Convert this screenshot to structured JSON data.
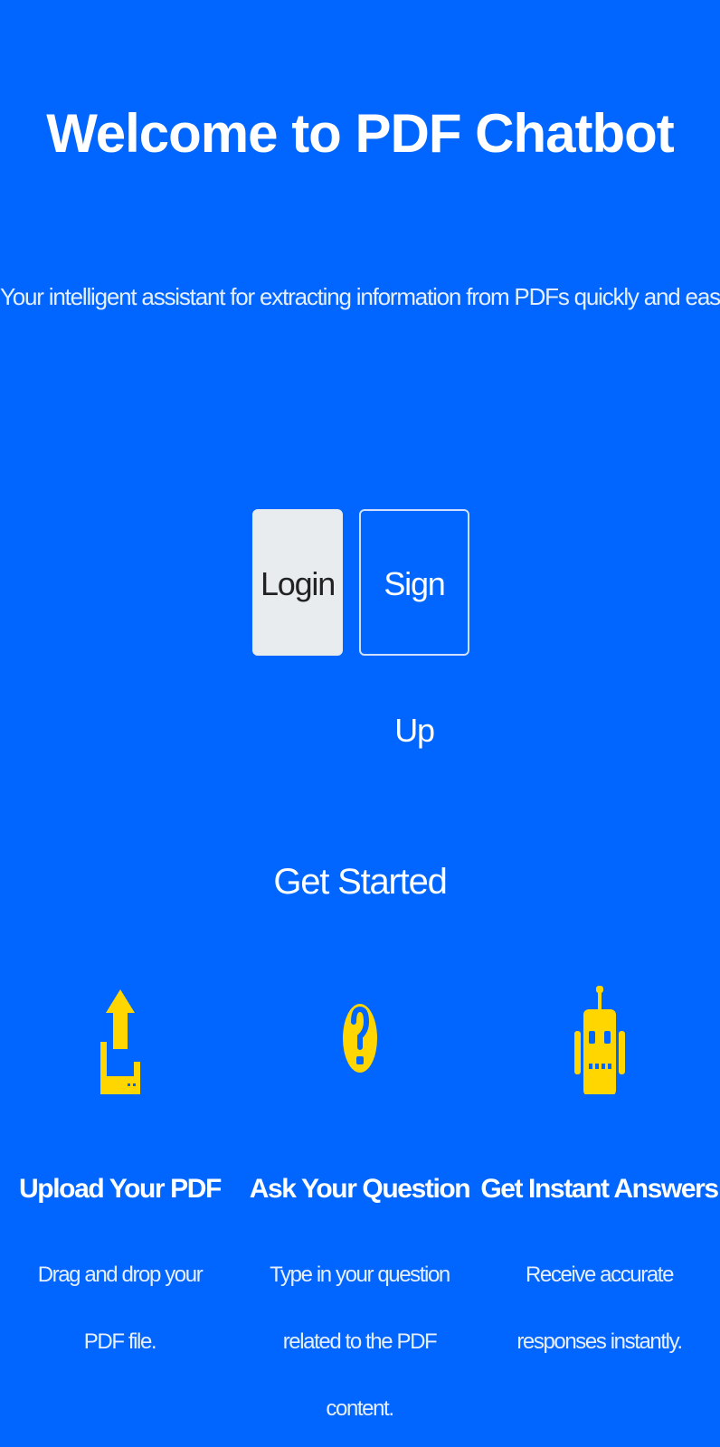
{
  "hero": {
    "title": "Welcome to PDF Chatbot",
    "subtitle": "Your intelligent assistant for extracting information from PDFs quickly and easily."
  },
  "actions": {
    "login_label": "Login",
    "signup_label": "Sign Up"
  },
  "get_started": {
    "title": "Get Started",
    "features": [
      {
        "icon": "upload-icon",
        "title": "Upload Your PDF",
        "description": "Drag and drop your PDF file."
      },
      {
        "icon": "question-icon",
        "title": "Ask Your Question",
        "description": "Type in your question related to the PDF content."
      },
      {
        "icon": "robot-icon",
        "title": "Get Instant Answers",
        "description": "Receive accurate responses instantly."
      }
    ]
  },
  "colors": {
    "background": "#0066ff",
    "icon_accent": "#ffd600",
    "login_button_bg": "#e9ecef"
  }
}
